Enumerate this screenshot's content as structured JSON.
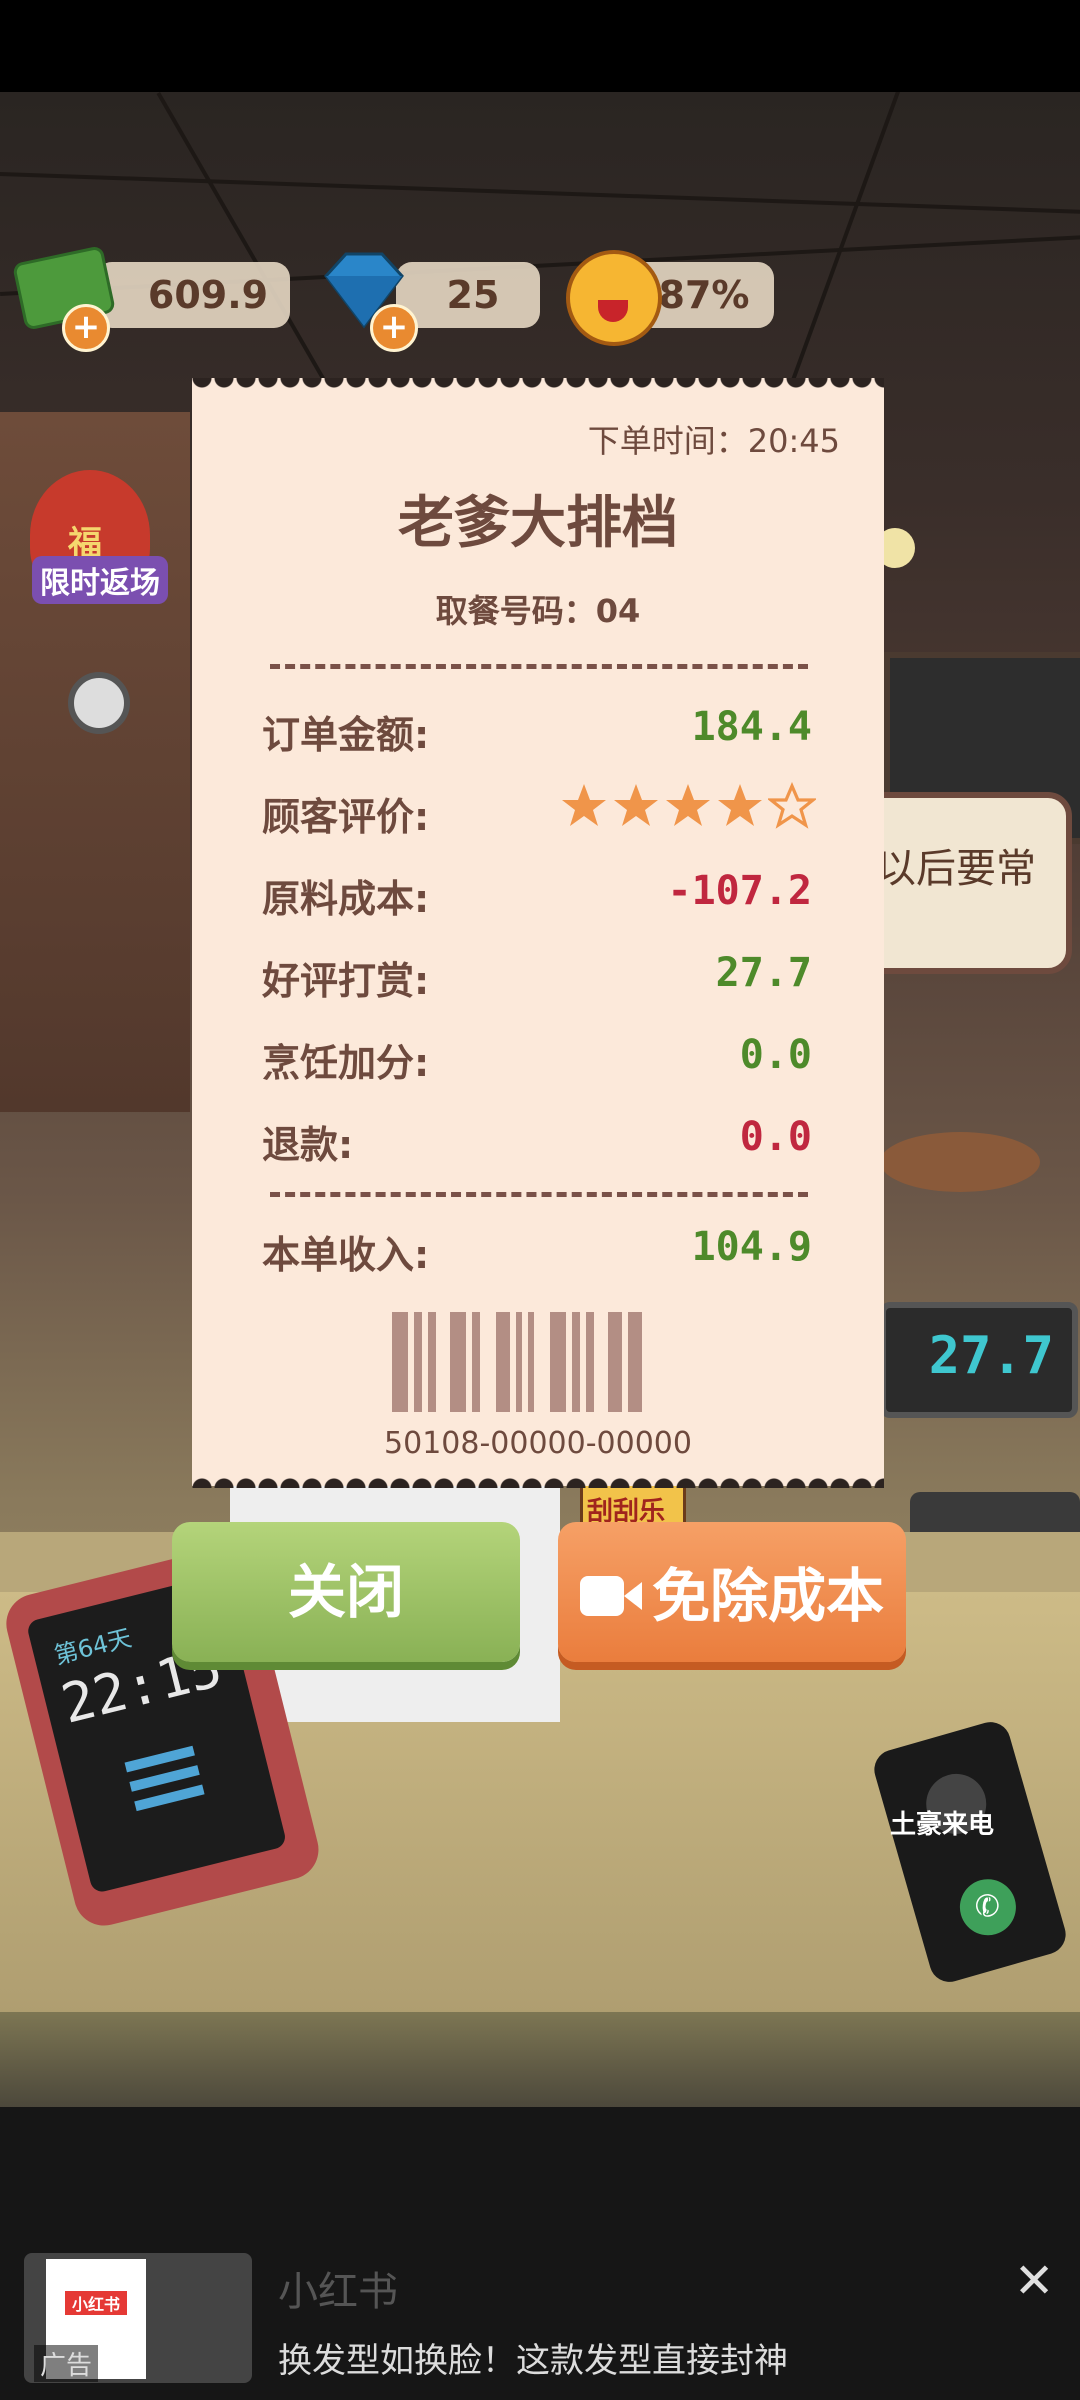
{
  "hud": {
    "money": "609.9",
    "gems": "25",
    "satisfaction": "87%"
  },
  "event_badge": "限时返场",
  "event_char": "福",
  "scene": {
    "speech_text": "以后要常",
    "display_value": "27.7",
    "scratch_card": "刮刮乐",
    "tablet_day": "第64天",
    "tablet_time": "22:15",
    "phone_label": "土豪来电"
  },
  "receipt": {
    "order_time": "下单时间：20:45",
    "shop_name": "老爹大排档",
    "pickup_number": "取餐号码：04",
    "rows": [
      {
        "label": "订单金额:",
        "value": "184.4"
      },
      {
        "label": "顾客评价:",
        "value": ""
      },
      {
        "label": "原料成本:",
        "value": "-107.2"
      },
      {
        "label": "好评打赏:",
        "value": "27.7"
      },
      {
        "label": "烹饪加分:",
        "value": "0.0"
      },
      {
        "label": "退款:",
        "value": "0.0"
      }
    ],
    "rating": 4,
    "rating_max": 5,
    "income_label": "本单收入:",
    "income_value": "104.9",
    "barcode_number": "50108-00000-00000"
  },
  "buttons": {
    "close": "关闭",
    "free_cost": "免除成本"
  },
  "ad": {
    "brand": "小红书",
    "tag": "广告",
    "text": "换发型如换脸！这款发型直接封神",
    "thumb_logo": "小红书"
  },
  "colors": {
    "green": "#4e8a2a",
    "red": "#c0273f",
    "receipt_bg": "#fce9da"
  }
}
